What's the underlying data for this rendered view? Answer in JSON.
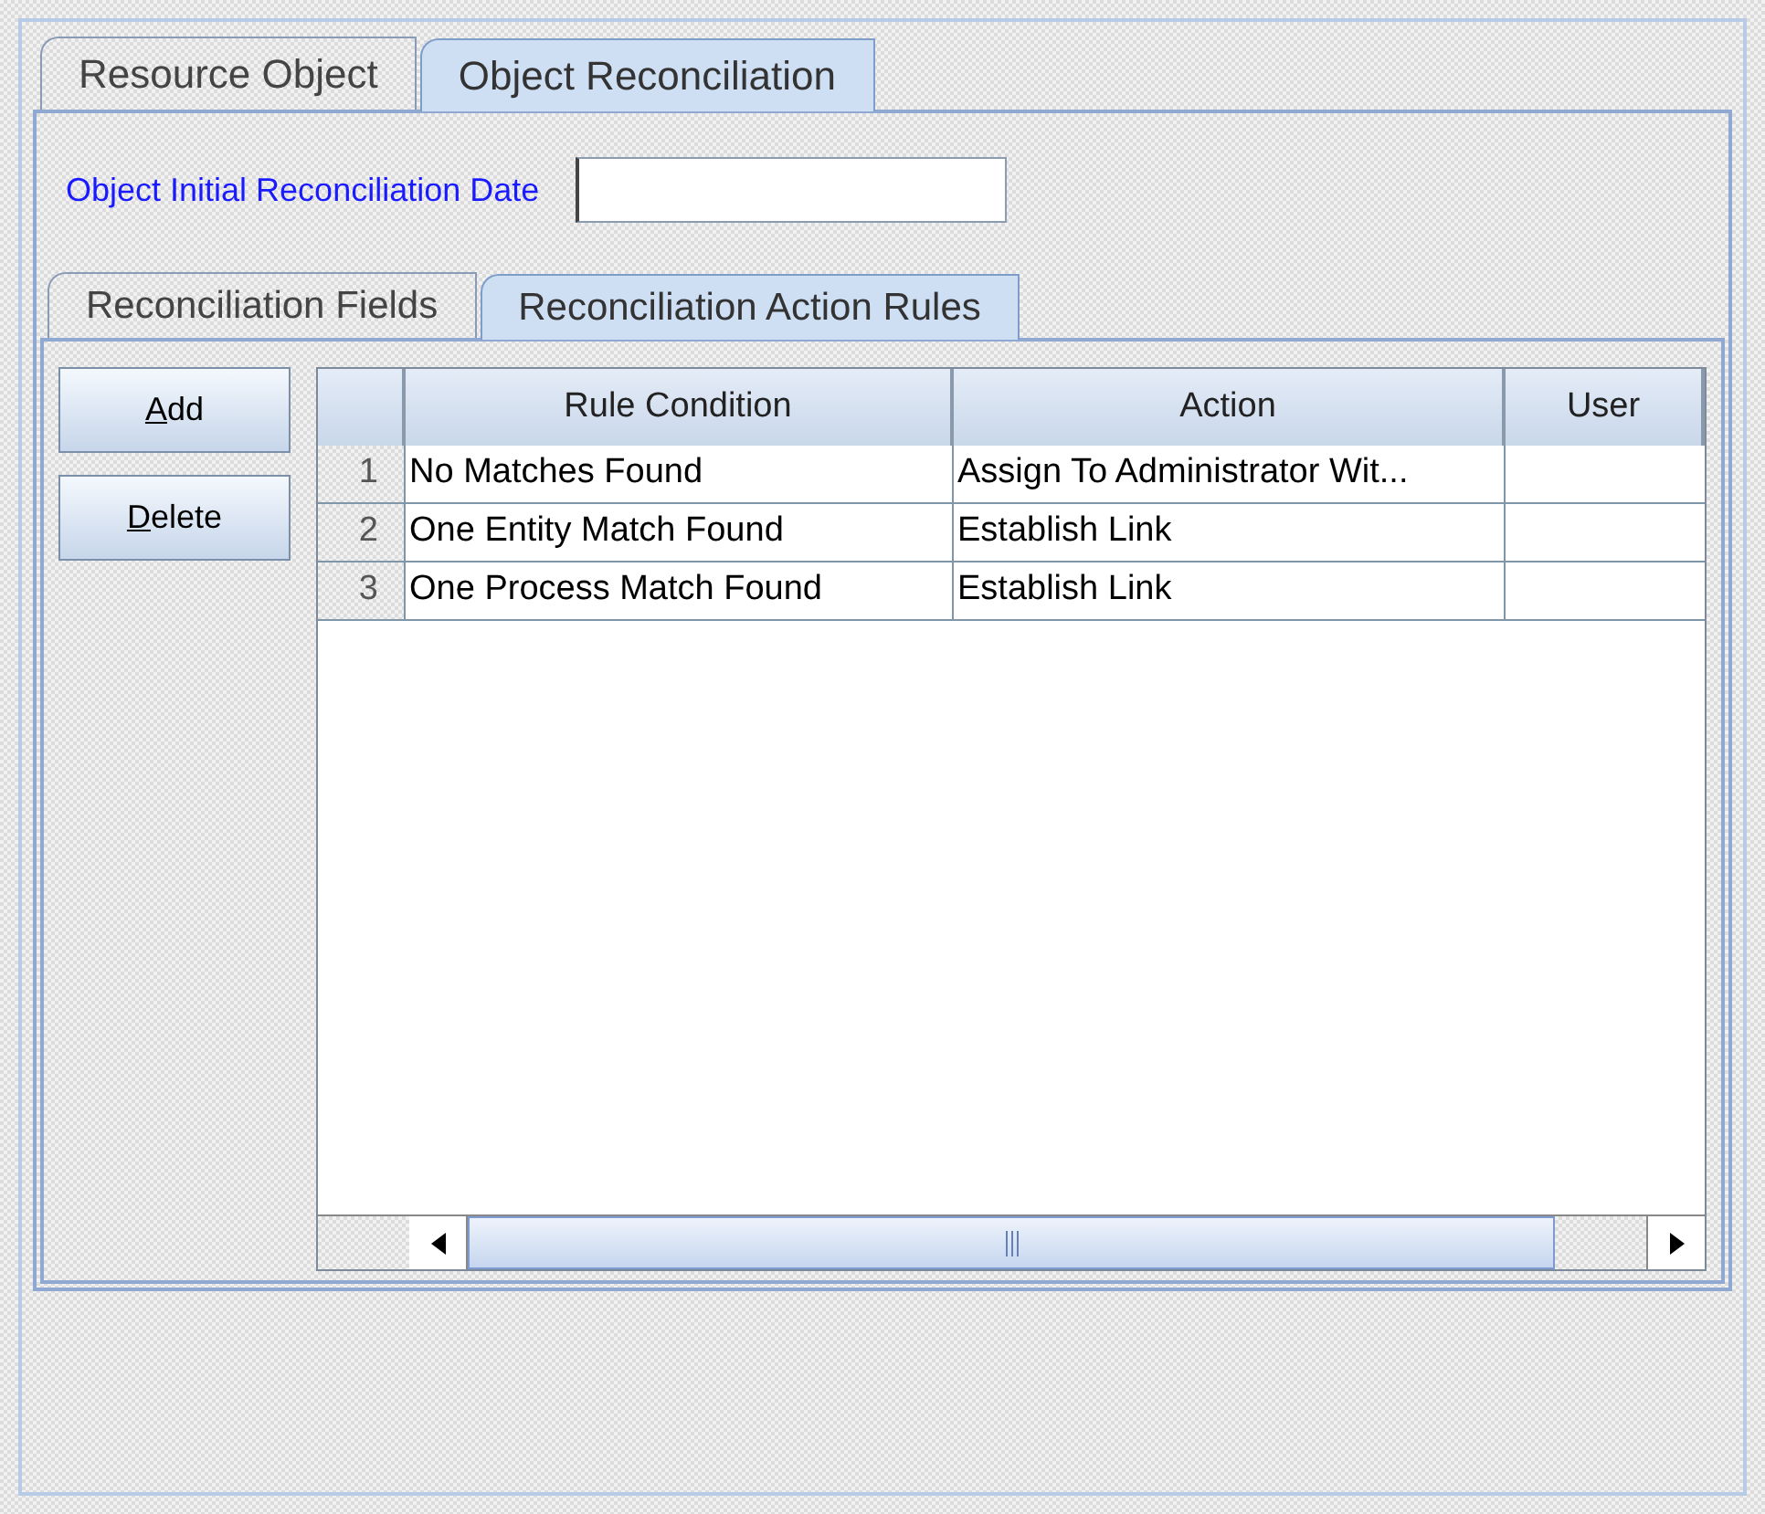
{
  "tabs": [
    {
      "label": "Resource Object",
      "selected": false
    },
    {
      "label": "Object Reconciliation",
      "selected": true
    }
  ],
  "date_field": {
    "label": "Object Initial Reconciliation Date"
  },
  "sub_tabs": [
    {
      "label": "Reconciliation Fields",
      "selected": false
    },
    {
      "label": "Reconciliation Action Rules",
      "selected": true
    }
  ],
  "buttons": [
    {
      "label": "Add",
      "mnemonic_underlined": true
    },
    {
      "label": "Delete",
      "mnemonic_underlined": true
    }
  ],
  "table": {
    "columns": [
      "Rule Condition",
      "Action",
      "User"
    ],
    "rows": [
      {
        "number": "1",
        "cells": [
          "No Matches Found",
          "Assign To Administrator Wit...",
          ""
        ]
      },
      {
        "number": "2",
        "cells": [
          "One Entity Match Found",
          "Establish Link",
          ""
        ]
      },
      {
        "number": "3",
        "cells": [
          "One Process Match Found",
          "Establish Link",
          ""
        ]
      }
    ]
  }
}
